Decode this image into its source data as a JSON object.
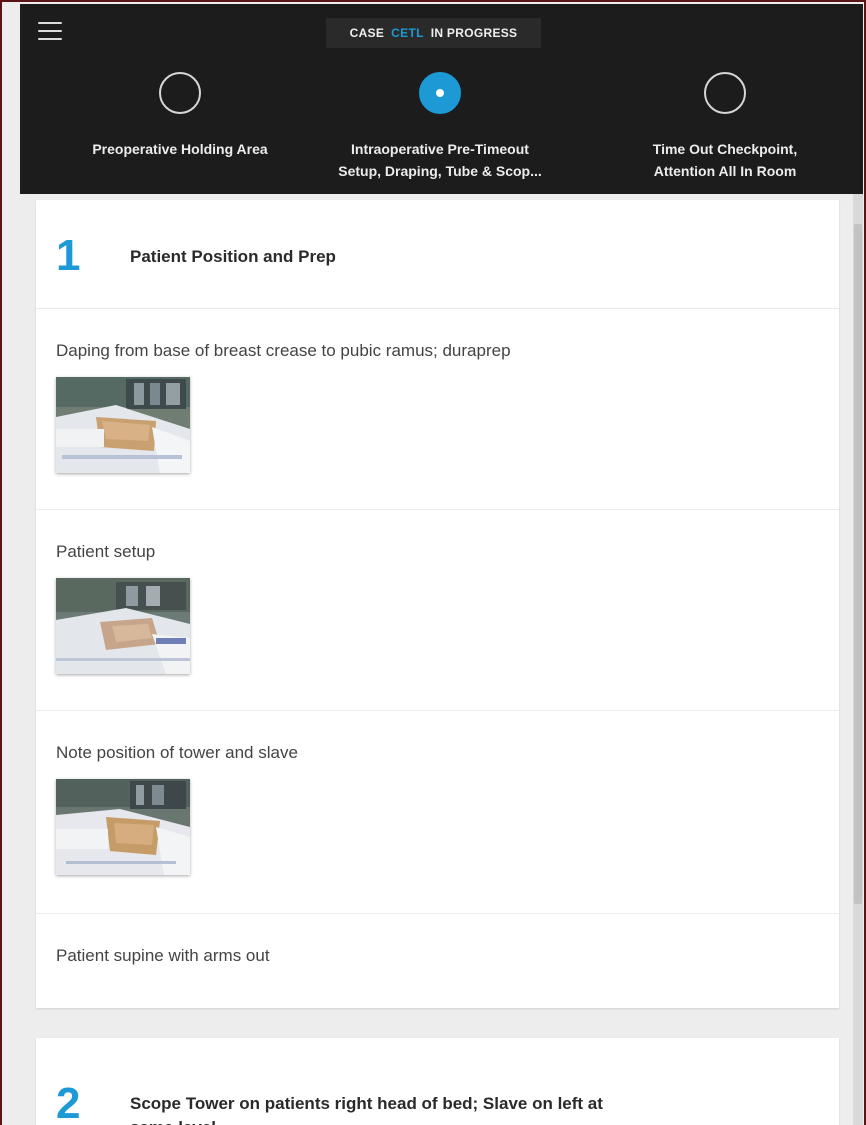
{
  "header": {
    "status_prefix": "CASE",
    "case_id": "CETL",
    "status_suffix": "IN PROGRESS"
  },
  "steps": [
    {
      "line1": "Preoperative Holding Area",
      "line2": "",
      "active": false
    },
    {
      "line1": "Intraoperative Pre-Timeout",
      "line2": "Setup, Draping, Tube & Scop...",
      "active": true
    },
    {
      "line1": "Time Out Checkpoint,",
      "line2": "Attention All In Room",
      "active": false
    }
  ],
  "sections": [
    {
      "number": "1",
      "title": "Patient Position and Prep",
      "items": [
        {
          "text": "Daping from base of breast crease to pubic ramus; duraprep",
          "has_image": true
        },
        {
          "text": "Patient setup",
          "has_image": true
        },
        {
          "text": "Note position of tower and slave",
          "has_image": true
        },
        {
          "text": "Patient supine with arms out",
          "has_image": false
        }
      ]
    },
    {
      "number": "2",
      "title_line1": "Scope Tower on patients right head of bed; Slave on left at",
      "title_line2": "same level"
    }
  ],
  "colors": {
    "accent": "#1d9ad6",
    "header_bg": "#1c1c1c",
    "content_bg": "#ededed"
  }
}
